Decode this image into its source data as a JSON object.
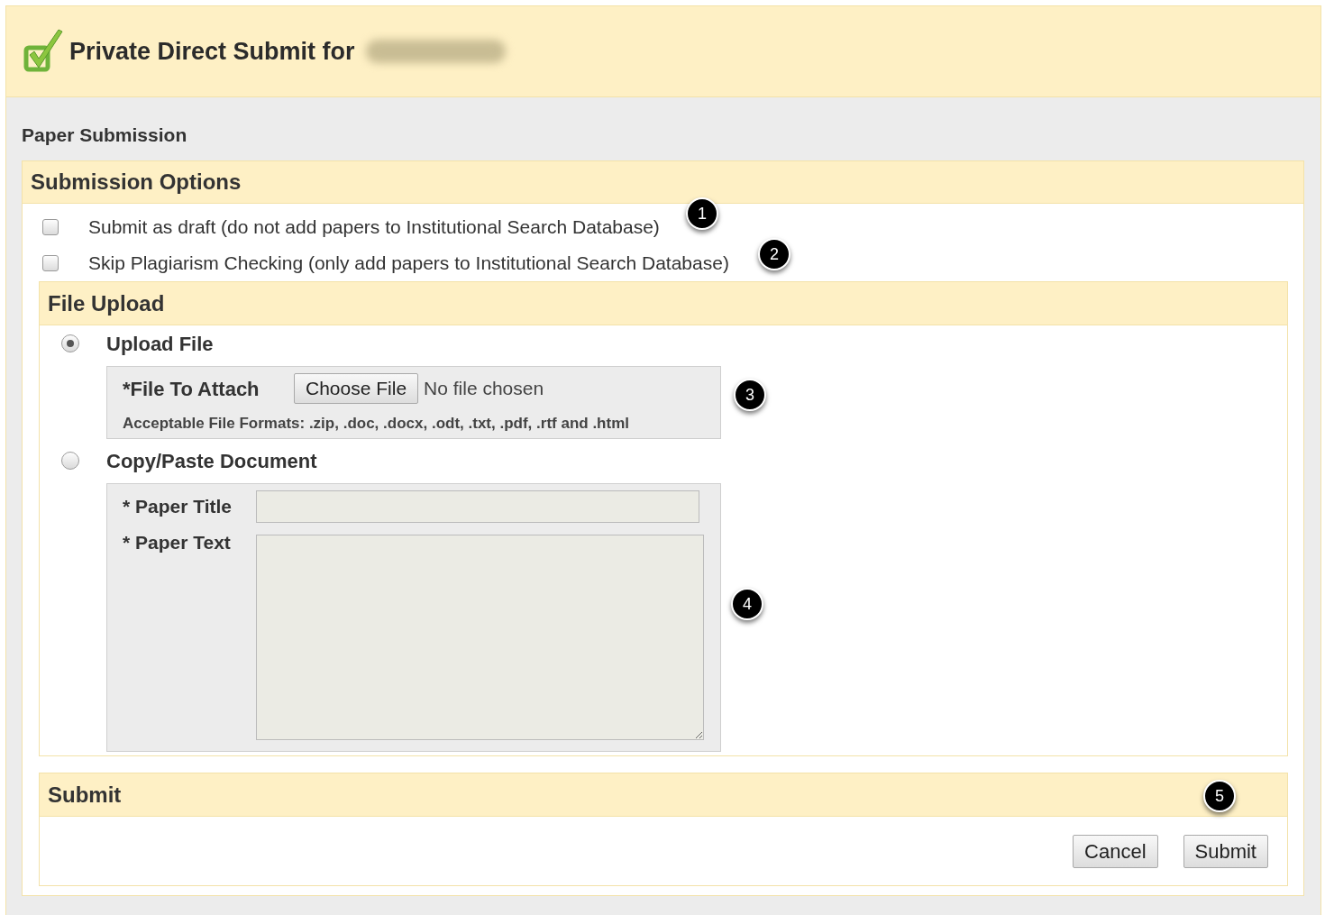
{
  "header": {
    "title": "Private Direct Submit for"
  },
  "page_heading": "Paper Submission",
  "submission_options": {
    "title": "Submission Options",
    "options": [
      {
        "label": "Submit as draft (do not add papers to Institutional Search Database)",
        "checked": false
      },
      {
        "label": "Skip Plagiarism Checking (only add papers to Institutional Search Database)",
        "checked": false
      }
    ]
  },
  "file_upload": {
    "title": "File Upload",
    "methods": [
      {
        "label": "Upload File",
        "selected": true
      },
      {
        "label": "Copy/Paste Document",
        "selected": false
      }
    ],
    "attach": {
      "label": "*File To Attach",
      "button": "Choose File",
      "status": "No file chosen",
      "formats": "Acceptable File Formats: .zip, .doc, .docx, .odt, .txt, .pdf, .rtf and .html"
    },
    "paste": {
      "title_label": "* Paper Title",
      "text_label": "* Paper Text"
    }
  },
  "submit": {
    "title": "Submit",
    "buttons": [
      "Cancel",
      "Submit"
    ]
  },
  "callouts": [
    "1",
    "2",
    "3",
    "4",
    "5"
  ]
}
